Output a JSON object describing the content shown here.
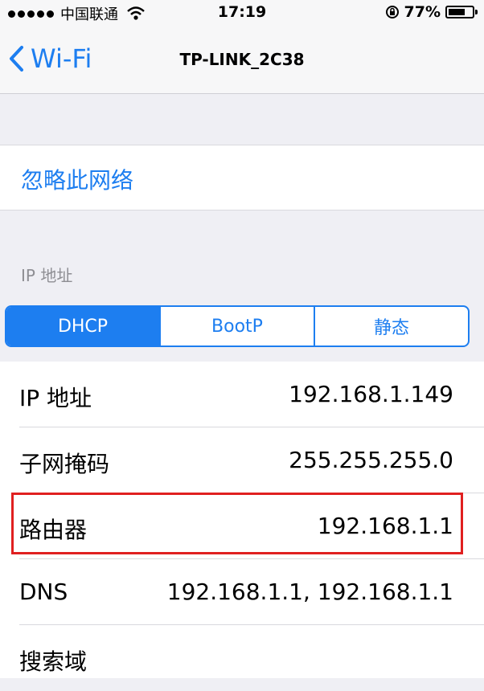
{
  "status_bar": {
    "carrier": "中国联通",
    "time": "17:19",
    "battery_percent": "77%",
    "battery_level": 0.77,
    "signal_bars": 5
  },
  "nav": {
    "back_label": "Wi-Fi",
    "title": "TP-LINK_2C38"
  },
  "forget_network": "忽略此网络",
  "section_header": "IP 地址",
  "segments": [
    {
      "label": "DHCP",
      "active": true
    },
    {
      "label": "BootP",
      "active": false
    },
    {
      "label": "静态",
      "active": false
    }
  ],
  "rows": [
    {
      "label": "IP 地址",
      "value": "192.168.1.149"
    },
    {
      "label": "子网掩码",
      "value": "255.255.255.0"
    },
    {
      "label": "路由器",
      "value": "192.168.1.1"
    },
    {
      "label": "DNS",
      "value": "192.168.1.1, 192.168.1.1"
    },
    {
      "label": "搜索域",
      "value": ""
    }
  ],
  "colors": {
    "accent": "#1d7ef0",
    "highlight": "#e02020",
    "background": "#efeff4"
  },
  "icons": [
    "signal-dots-icon",
    "wifi-icon",
    "rotation-lock-icon",
    "battery-icon",
    "chevron-left-icon"
  ]
}
